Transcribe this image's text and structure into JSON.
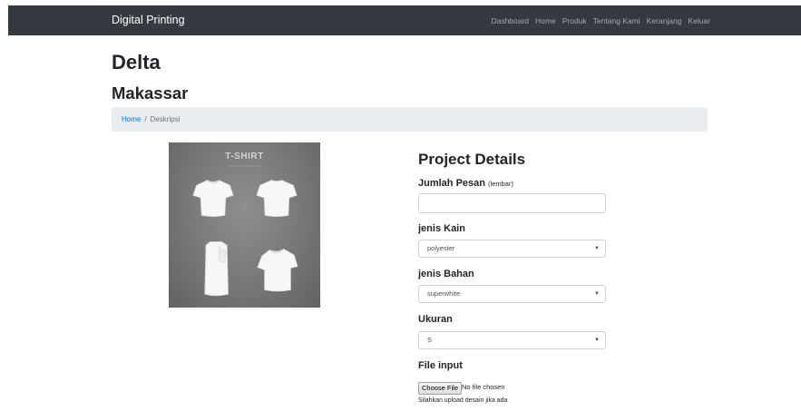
{
  "navbar": {
    "brand": "Digital Printing",
    "links": [
      "Dashboard",
      "Home",
      "Produk",
      "Tentang Kami",
      "Keranjang",
      "Keluar"
    ]
  },
  "page": {
    "title": "Delta",
    "subtitle": "Makassar"
  },
  "breadcrumb": {
    "home": "Home",
    "separator": "/",
    "current": "Deskripsi"
  },
  "product_image": {
    "title": "T-SHIRT",
    "subtitle": "TEMPLATE DESIGN",
    "icon": "t-shirt-mockup-image"
  },
  "form": {
    "heading": "Project Details",
    "quantity": {
      "label": "Jumlah Pesan",
      "unit": "(lembar)",
      "value": ""
    },
    "fabric": {
      "label": "jenis Kain",
      "selected": "polyester"
    },
    "material": {
      "label": "jenis Bahan",
      "selected": "superwhite"
    },
    "size": {
      "label": "Ukuran",
      "selected": "S"
    },
    "file": {
      "label": "File input",
      "button": "Choose File",
      "status": "No file chosen",
      "help": "Silahkan upload desain jika ada"
    }
  },
  "colors": {
    "navbar_bg": "#343a40",
    "link": "#007bff",
    "breadcrumb_bg": "#e9ecef"
  }
}
